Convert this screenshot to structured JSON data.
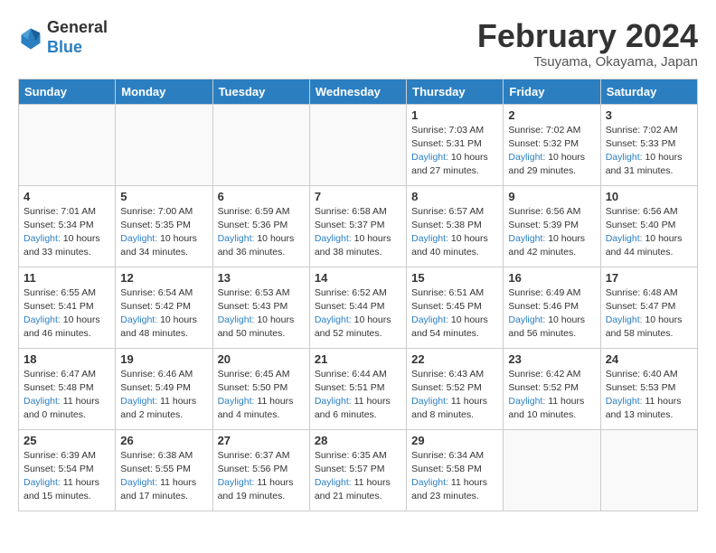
{
  "header": {
    "logo_text_general": "General",
    "logo_text_blue": "Blue",
    "month_title": "February 2024",
    "location": "Tsuyama, Okayama, Japan"
  },
  "weekdays": [
    "Sunday",
    "Monday",
    "Tuesday",
    "Wednesday",
    "Thursday",
    "Friday",
    "Saturday"
  ],
  "weeks": [
    [
      {
        "day": "",
        "empty": true
      },
      {
        "day": "",
        "empty": true
      },
      {
        "day": "",
        "empty": true
      },
      {
        "day": "",
        "empty": true
      },
      {
        "day": "1",
        "sunrise": "7:03 AM",
        "sunset": "5:31 PM",
        "daylight": "10 hours and 27 minutes."
      },
      {
        "day": "2",
        "sunrise": "7:02 AM",
        "sunset": "5:32 PM",
        "daylight": "10 hours and 29 minutes."
      },
      {
        "day": "3",
        "sunrise": "7:02 AM",
        "sunset": "5:33 PM",
        "daylight": "10 hours and 31 minutes."
      }
    ],
    [
      {
        "day": "4",
        "sunrise": "7:01 AM",
        "sunset": "5:34 PM",
        "daylight": "10 hours and 33 minutes."
      },
      {
        "day": "5",
        "sunrise": "7:00 AM",
        "sunset": "5:35 PM",
        "daylight": "10 hours and 34 minutes."
      },
      {
        "day": "6",
        "sunrise": "6:59 AM",
        "sunset": "5:36 PM",
        "daylight": "10 hours and 36 minutes."
      },
      {
        "day": "7",
        "sunrise": "6:58 AM",
        "sunset": "5:37 PM",
        "daylight": "10 hours and 38 minutes."
      },
      {
        "day": "8",
        "sunrise": "6:57 AM",
        "sunset": "5:38 PM",
        "daylight": "10 hours and 40 minutes."
      },
      {
        "day": "9",
        "sunrise": "6:56 AM",
        "sunset": "5:39 PM",
        "daylight": "10 hours and 42 minutes."
      },
      {
        "day": "10",
        "sunrise": "6:56 AM",
        "sunset": "5:40 PM",
        "daylight": "10 hours and 44 minutes."
      }
    ],
    [
      {
        "day": "11",
        "sunrise": "6:55 AM",
        "sunset": "5:41 PM",
        "daylight": "10 hours and 46 minutes."
      },
      {
        "day": "12",
        "sunrise": "6:54 AM",
        "sunset": "5:42 PM",
        "daylight": "10 hours and 48 minutes."
      },
      {
        "day": "13",
        "sunrise": "6:53 AM",
        "sunset": "5:43 PM",
        "daylight": "10 hours and 50 minutes."
      },
      {
        "day": "14",
        "sunrise": "6:52 AM",
        "sunset": "5:44 PM",
        "daylight": "10 hours and 52 minutes."
      },
      {
        "day": "15",
        "sunrise": "6:51 AM",
        "sunset": "5:45 PM",
        "daylight": "10 hours and 54 minutes."
      },
      {
        "day": "16",
        "sunrise": "6:49 AM",
        "sunset": "5:46 PM",
        "daylight": "10 hours and 56 minutes."
      },
      {
        "day": "17",
        "sunrise": "6:48 AM",
        "sunset": "5:47 PM",
        "daylight": "10 hours and 58 minutes."
      }
    ],
    [
      {
        "day": "18",
        "sunrise": "6:47 AM",
        "sunset": "5:48 PM",
        "daylight": "11 hours and 0 minutes."
      },
      {
        "day": "19",
        "sunrise": "6:46 AM",
        "sunset": "5:49 PM",
        "daylight": "11 hours and 2 minutes."
      },
      {
        "day": "20",
        "sunrise": "6:45 AM",
        "sunset": "5:50 PM",
        "daylight": "11 hours and 4 minutes."
      },
      {
        "day": "21",
        "sunrise": "6:44 AM",
        "sunset": "5:51 PM",
        "daylight": "11 hours and 6 minutes."
      },
      {
        "day": "22",
        "sunrise": "6:43 AM",
        "sunset": "5:52 PM",
        "daylight": "11 hours and 8 minutes."
      },
      {
        "day": "23",
        "sunrise": "6:42 AM",
        "sunset": "5:52 PM",
        "daylight": "11 hours and 10 minutes."
      },
      {
        "day": "24",
        "sunrise": "6:40 AM",
        "sunset": "5:53 PM",
        "daylight": "11 hours and 13 minutes."
      }
    ],
    [
      {
        "day": "25",
        "sunrise": "6:39 AM",
        "sunset": "5:54 PM",
        "daylight": "11 hours and 15 minutes."
      },
      {
        "day": "26",
        "sunrise": "6:38 AM",
        "sunset": "5:55 PM",
        "daylight": "11 hours and 17 minutes."
      },
      {
        "day": "27",
        "sunrise": "6:37 AM",
        "sunset": "5:56 PM",
        "daylight": "11 hours and 19 minutes."
      },
      {
        "day": "28",
        "sunrise": "6:35 AM",
        "sunset": "5:57 PM",
        "daylight": "11 hours and 21 minutes."
      },
      {
        "day": "29",
        "sunrise": "6:34 AM",
        "sunset": "5:58 PM",
        "daylight": "11 hours and 23 minutes."
      },
      {
        "day": "",
        "empty": true
      },
      {
        "day": "",
        "empty": true
      }
    ]
  ],
  "labels": {
    "sunrise": "Sunrise: ",
    "sunset": "Sunset: ",
    "daylight": "Daylight: "
  }
}
